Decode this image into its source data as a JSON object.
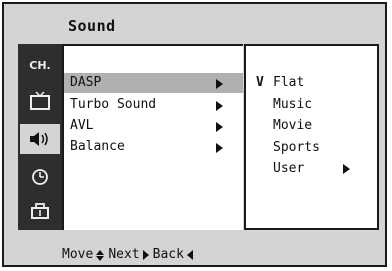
{
  "window": {
    "title": "Sound"
  },
  "sidebar": {
    "items": [
      {
        "label": "CH.",
        "icon": "channel-icon"
      },
      {
        "label": "",
        "icon": "tv-picture-icon"
      },
      {
        "label": "",
        "icon": "speaker-sound-icon",
        "active": true
      },
      {
        "label": "",
        "icon": "clock-timer-icon"
      },
      {
        "label": "",
        "icon": "setup-toolbox-icon"
      }
    ]
  },
  "menu": {
    "items": [
      {
        "label": "DASP",
        "selected": true
      },
      {
        "label": "Turbo Sound"
      },
      {
        "label": "AVL"
      },
      {
        "label": "Balance"
      }
    ]
  },
  "submenu": {
    "items": [
      {
        "label": "Flat",
        "check": "V"
      },
      {
        "label": "Music"
      },
      {
        "label": "Movie"
      },
      {
        "label": "Sports"
      },
      {
        "label": "User"
      }
    ]
  },
  "footer": {
    "move": "Move",
    "next": "Next",
    "back": "Back"
  },
  "colors": {
    "panel": "#ffffff",
    "frame": "#d4d4d4",
    "sidebar": "#2e2e2e",
    "highlight": "#b0b0b0"
  }
}
